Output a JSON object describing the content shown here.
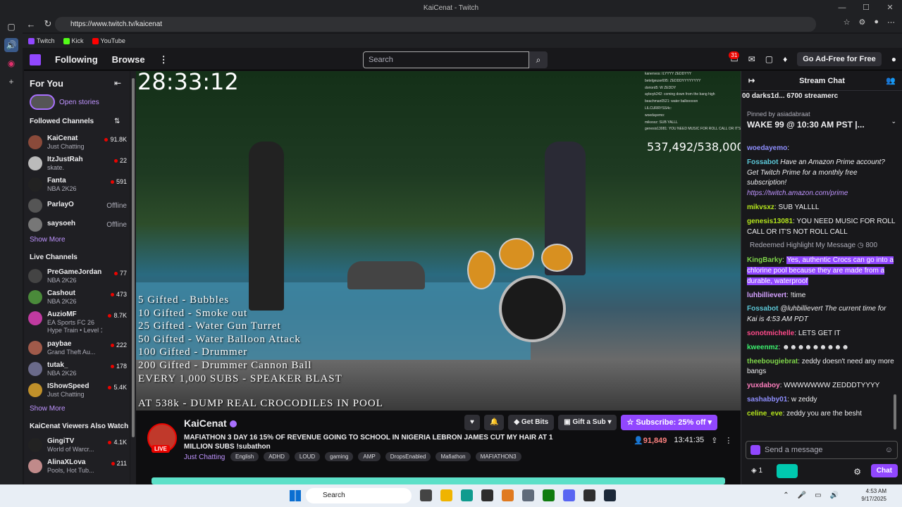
{
  "window_title": "KaiCenat - Twitch",
  "url": "https://www.twitch.tv/kaicenat",
  "bookmarks": [
    "Twitch",
    "Kick",
    "YouTube"
  ],
  "topnav": {
    "following": "Following",
    "browse": "Browse",
    "search_placeholder": "Search",
    "notif_count": "31",
    "ad_free": "Go Ad-Free for Free"
  },
  "leftnav": {
    "for_you": "For You",
    "open_stories": "Open stories",
    "followed_header": "Followed Channels",
    "followed": [
      {
        "name": "KaiCenat",
        "game": "Just Chatting",
        "viewers": "91.8K"
      },
      {
        "name": "ItzJustRah",
        "game": "skate.",
        "viewers": "22"
      },
      {
        "name": "Fanta",
        "game": "NBA 2K26",
        "viewers": "591"
      },
      {
        "name": "ParlayO",
        "game": "",
        "viewers": "Offline"
      },
      {
        "name": "saysoeh",
        "game": "",
        "viewers": "Offline"
      }
    ],
    "show_more": "Show More",
    "live_header": "Live Channels",
    "live": [
      {
        "name": "PreGameJordan",
        "game": "NBA 2K26",
        "viewers": "77"
      },
      {
        "name": "Cashout",
        "game": "NBA 2K26",
        "viewers": "473"
      },
      {
        "name": "AuzioMF",
        "game": "EA Sports FC 26",
        "viewers": "8.7K",
        "extra": "Hype Train • Level 1"
      },
      {
        "name": "paybae",
        "game": "Grand Theft Au...",
        "viewers": "222"
      },
      {
        "name": "tutak_",
        "game": "NBA 2K26",
        "viewers": "178"
      },
      {
        "name": "IShowSpeed",
        "game": "Just Chatting",
        "viewers": "5.4K"
      }
    ],
    "also_watch_header": "KaiCenat Viewers Also Watch",
    "also_watch": [
      {
        "name": "GingiTV",
        "game": "World of Warcr...",
        "viewers": "4.1K"
      },
      {
        "name": "AlinaXLova",
        "game": "Pools, Hot Tub...",
        "viewers": "211"
      }
    ]
  },
  "video": {
    "timer": "28:33:12",
    "sub_count": "537,492/538,000",
    "gifted_lines": [
      "5 Gifted - Bubbles",
      "10 Gifted - Smoke out",
      "25 Gifted - Water Gun Turret",
      "50 Gifted - Water Balloon Attack",
      "100 Gifted - Drummer",
      "200 Gifted - Drummer Cannon Ball",
      "EVERY 1,000 SUBS - SPEAKER BLAST"
    ],
    "dump_line": "AT 538k - DUMP REAL CROCODILES IN POOL",
    "overlay_chat": [
      "kanenvos: ILYYYY ZEDDYYY",
      "betelgeuse695: ZEDDDYYYYYYYY",
      "doriord5: W ZEDDY",
      "ayboyk242: coming down from the bang high",
      "beachman0521: water ballooooon",
      "LILCURRYSS4c:",
      "woedayemo:",
      "mikvsxz: SUB YALLL",
      "genesis13081: YOU NEED MUSIC FOR ROLL CALL OR IT'S NOT ROLL CALL"
    ]
  },
  "stream": {
    "name": "KaiCenat",
    "live": "LIVE",
    "title": "MAFIATHON 3 DAY 16 15% OF REVENUE GOING TO SCHOOL IN NIGERIA LEBRON JAMES CUT MY HAIR AT 1 MILLION SUBS !subathon",
    "category": "Just Chatting",
    "tags": [
      "English",
      "ADHD",
      "LOUD",
      "gaming",
      "AMP",
      "DropsEnabled",
      "Mafiathon",
      "MAFIATHON3"
    ],
    "get_bits": "Get Bits",
    "gift_sub": "Gift a Sub",
    "subscribe": "Subscribe: 25% off",
    "viewers": "91,849",
    "uptime": "13:41:35"
  },
  "chat": {
    "header": "Stream Chat",
    "gifters": "00  darks1d... 6700  streamerc",
    "pinned_by": "Pinned by asiadabraat",
    "pinned_text": "WAKE 99 @ 10:30 AM PST |...",
    "messages": [
      {
        "user": "woedayemo",
        "text": "",
        "color": "#8f8fff"
      },
      {
        "user": "Fossabot",
        "text": "Have an Amazon Prime account? Get Twitch Prime for a monthly free subscription!",
        "color": "#5cc8d8",
        "italic": true
      },
      {
        "user": "",
        "text": "https://twitch.amazon.com/prime",
        "color": "",
        "link": true
      },
      {
        "user": "mikvsxz",
        "text": "SUB YALLLL",
        "color": "#b5e61d"
      },
      {
        "user": "genesis13081",
        "text": "YOU NEED MUSIC FOR ROLL CALL OR IT'S NOT ROLL CALL",
        "color": "#b5e61d"
      }
    ],
    "redeem_label": "Redeemed Highlight My Message",
    "redeem_cost": "800",
    "highlight_user": "KingBarky",
    "highlight_text": "Yes, authentic Crocs can go into a chlorine pool because they are made from a durable, waterproof",
    "messages2": [
      {
        "user": "luhbillievert",
        "text": "!time",
        "color": "#d4a0ff"
      },
      {
        "user": "Fossabot",
        "text": "@luhbillievert The current time for Kai is 4:53 AM PDT",
        "color": "#5cc8d8",
        "italic": true
      },
      {
        "user": "sonotmichelle",
        "text": "LETS GET IT",
        "color": "#ff4a8a"
      },
      {
        "user": "kweenmz",
        "text": "",
        "color": "#3cf06e"
      },
      {
        "user": "theebougiebrat",
        "text": "zeddy doesn't need any more bangs",
        "color": "#7fd64a"
      },
      {
        "user": "yuxdaboy",
        "text": "WWWWWWW ZEDDDTYYYY",
        "color": "#ff7fbf"
      },
      {
        "user": "sashabby01",
        "text": "w zeddy",
        "color": "#8f8fff"
      },
      {
        "user": "celine_eve",
        "text": "zeddy you are the besht",
        "color": "#b5e61d"
      }
    ],
    "input_placeholder": "Send a message",
    "points": "1",
    "chat_button": "Chat"
  },
  "taskbar": {
    "search": "Search",
    "time": "4:53 AM",
    "date": "9/17/2025"
  }
}
